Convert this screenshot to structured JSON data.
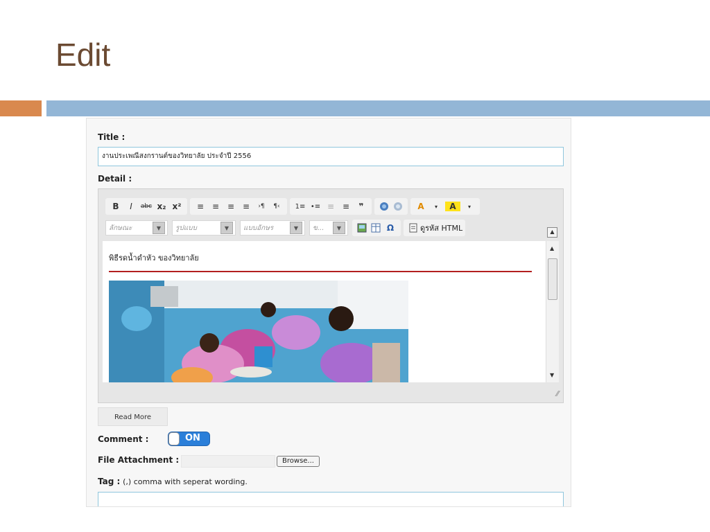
{
  "slide": {
    "title": "Edit"
  },
  "form": {
    "title_label": "Title :",
    "title_value": "งานประเพณีสงกรานต์ของวิทยาลัย ประจำปี 2556",
    "detail_label": "Detail :",
    "comment_label": "Comment :",
    "comment_toggle": "ON",
    "file_label": "File Attachment :",
    "browse_label": "Browse...",
    "tag_label": "Tag :",
    "tag_hint": "(,) comma with seperat wording.",
    "read_more": "Read More"
  },
  "toolbar": {
    "row1": [
      "B",
      "I",
      "abc",
      "x₂",
      "x²",
      "≡",
      "≡",
      "≡",
      "≡",
      "›¶",
      "¶‹",
      "1≡",
      "•≡",
      "≡",
      "≡",
      "❞",
      "A",
      "A"
    ],
    "style_combo": "ลักษณะ",
    "format_combo": "รูปแบบ",
    "font_combo": "แบบอักษร",
    "size_combo": "ข...",
    "source_label": "ดูรหัส HTML"
  },
  "content": {
    "heading": "พิธีรดน้ำดำหัว ของวิทยาลัย"
  }
}
